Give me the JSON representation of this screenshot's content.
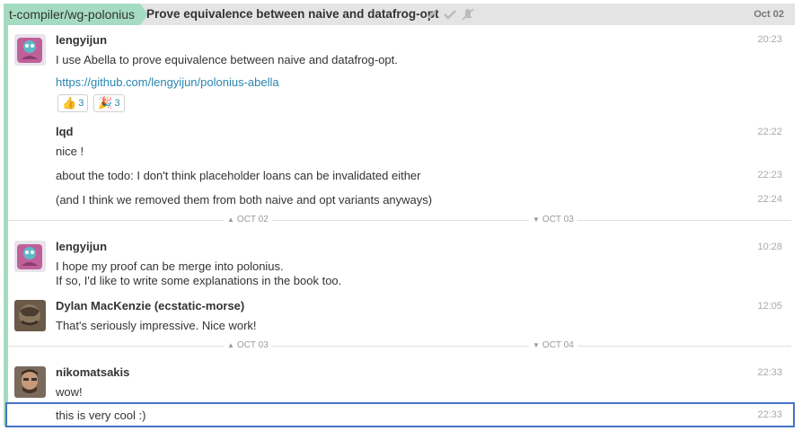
{
  "header": {
    "stream": "t-compiler/wg-polonius",
    "topic": "Prove equivalence between naive and datafrog-opt",
    "date": "Oct 02",
    "icons": [
      "pencil-icon",
      "check-icon",
      "mute-icon"
    ]
  },
  "messages": [
    {
      "sender": "lengyijun",
      "time": "20:23",
      "text": "I use Abella to prove equivalence between naive and datafrog-opt.",
      "link": "https://github.com/lengyijun/polonius-abella"
    },
    {
      "sender": "lqd",
      "time": "22:22",
      "text": "nice !"
    },
    {
      "time": "22:23",
      "text": "about the todo: I don't think placeholder loans can be invalidated either"
    },
    {
      "time": "22:24",
      "text": "(and I think we removed them from both naive and opt variants anyways)"
    },
    {
      "sender": "lengyijun",
      "time": "10:28",
      "line1": "I hope my proof can be merge into polonius.",
      "line2": "If so, I'd like to write some explanations in the book too."
    },
    {
      "sender": "Dylan MacKenzie (ecstatic-morse)",
      "time": "12:05",
      "text": "That's seriously impressive. Nice work!"
    },
    {
      "sender": "nikomatsakis",
      "time": "22:33",
      "text": "wow!"
    },
    {
      "time": "22:33",
      "text": "this is very cool :)"
    }
  ],
  "reactions": [
    {
      "emoji": "👍",
      "count": "3"
    },
    {
      "emoji": "🎉",
      "count": "3"
    }
  ],
  "dividers": [
    {
      "left": "OCT 02",
      "right": "OCT 03"
    },
    {
      "left": "OCT 03",
      "right": "OCT 04"
    }
  ],
  "colors": {
    "stream": "#a5dcc1",
    "link": "#2a86b0",
    "selection": "#4472c4"
  }
}
